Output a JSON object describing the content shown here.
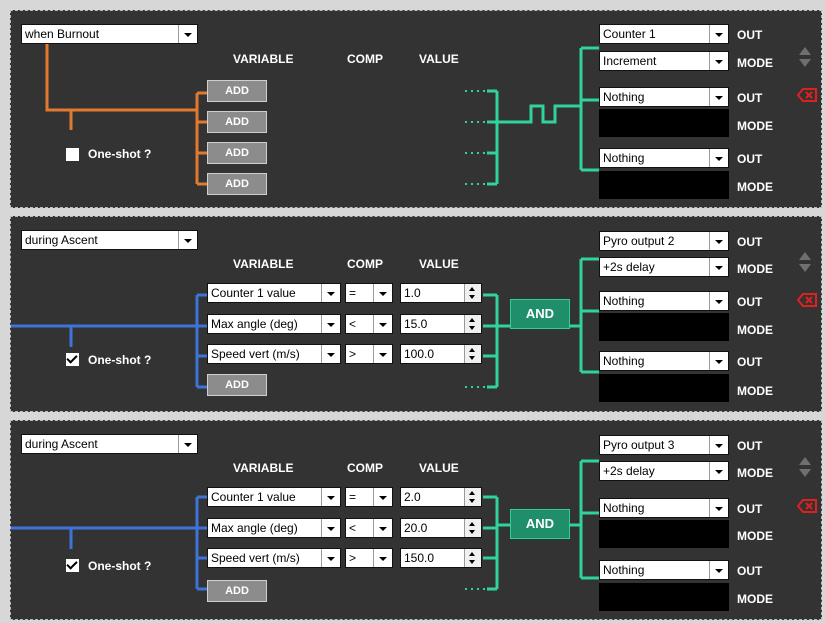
{
  "headers": {
    "variable": "VARIABLE",
    "comp": "COMP",
    "value": "VALUE",
    "out": "OUT",
    "mode": "MODE"
  },
  "colors": {
    "panel_bg": "#333333",
    "wire_orange": "#e07a2e",
    "wire_blue": "#3d74d8",
    "wire_green": "#2fd39b",
    "and_bg": "#1f8f6b",
    "delete_red": "#e02020"
  },
  "icons": {
    "move_up": "triangle-up-icon",
    "move_down": "triangle-down-icon",
    "delete": "backspace-x-icon"
  },
  "panels": [
    {
      "trigger": "when Burnout",
      "oneshot_label": "One-shot ?",
      "oneshot_checked": false,
      "add_labels": [
        "ADD",
        "ADD",
        "ADD",
        "ADD"
      ],
      "outputs": [
        {
          "out": "Counter 1",
          "mode": "Increment"
        },
        {
          "out": "Nothing",
          "mode": ""
        },
        {
          "out": "Nothing",
          "mode": ""
        }
      ]
    },
    {
      "trigger": "during Ascent",
      "oneshot_label": "One-shot ?",
      "oneshot_checked": true,
      "conditions": [
        {
          "variable": "Counter 1 value",
          "comp": "=",
          "value": "1.0"
        },
        {
          "variable": "Max angle (deg)",
          "comp": "<",
          "value": "15.0"
        },
        {
          "variable": "Speed vert (m/s)",
          "comp": ">",
          "value": "100.0"
        }
      ],
      "add_label": "ADD",
      "and_label": "AND",
      "outputs": [
        {
          "out": "Pyro output 2",
          "mode": "+2s delay"
        },
        {
          "out": "Nothing",
          "mode": ""
        },
        {
          "out": "Nothing",
          "mode": ""
        }
      ]
    },
    {
      "trigger": "during Ascent",
      "oneshot_label": "One-shot ?",
      "oneshot_checked": true,
      "conditions": [
        {
          "variable": "Counter 1 value",
          "comp": "=",
          "value": "2.0"
        },
        {
          "variable": "Max angle (deg)",
          "comp": "<",
          "value": "20.0"
        },
        {
          "variable": "Speed vert (m/s)",
          "comp": ">",
          "value": "150.0"
        }
      ],
      "add_label": "ADD",
      "and_label": "AND",
      "outputs": [
        {
          "out": "Pyro output 3",
          "mode": "+2s delay"
        },
        {
          "out": "Nothing",
          "mode": ""
        },
        {
          "out": "Nothing",
          "mode": ""
        }
      ]
    }
  ]
}
